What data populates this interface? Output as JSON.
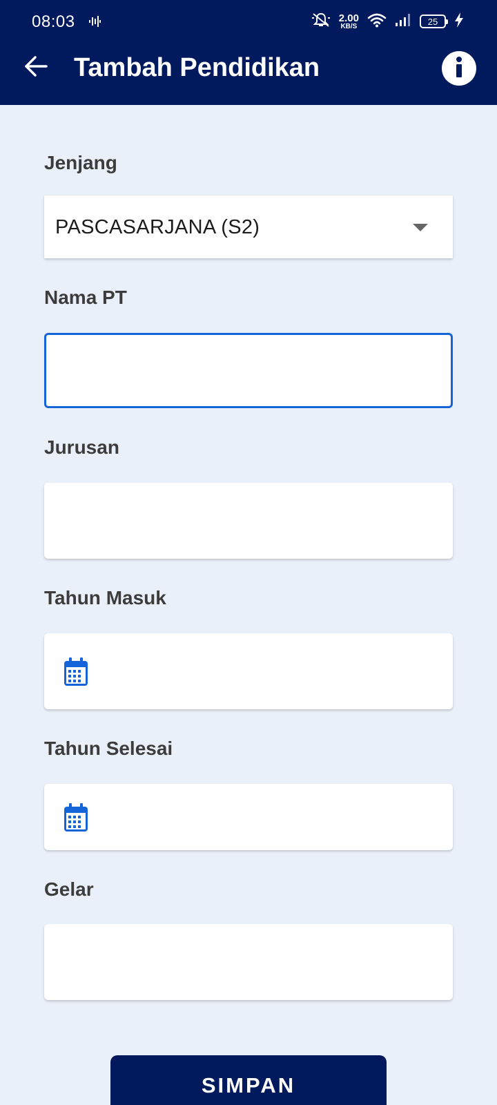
{
  "status_bar": {
    "time": "08:03",
    "net_speed_value": "2.00",
    "net_speed_unit": "KB/S",
    "battery": "25",
    "icons": [
      "audio-wave-icon",
      "bell-off-icon",
      "wifi-icon",
      "signal-icon",
      "battery-icon",
      "charging-icon"
    ]
  },
  "header": {
    "title": "Tambah Pendidikan",
    "back_icon": "arrow-left-icon",
    "info_icon": "info-icon"
  },
  "form": {
    "jenjang": {
      "label": "Jenjang",
      "value": "PASCASARJANA (S2)"
    },
    "nama_pt": {
      "label": "Nama PT",
      "value": ""
    },
    "jurusan": {
      "label": "Jurusan",
      "value": ""
    },
    "tahun_masuk": {
      "label": "Tahun Masuk",
      "value": ""
    },
    "tahun_selesai": {
      "label": "Tahun Selesai",
      "value": ""
    },
    "gelar": {
      "label": "Gelar",
      "value": ""
    }
  },
  "actions": {
    "save_label": "SIMPAN"
  },
  "colors": {
    "primary": "#011a5e",
    "background": "#eaf0fa",
    "focus": "#1565d8",
    "icon_blue": "#1565d8",
    "label_text": "#3c3c3c"
  }
}
